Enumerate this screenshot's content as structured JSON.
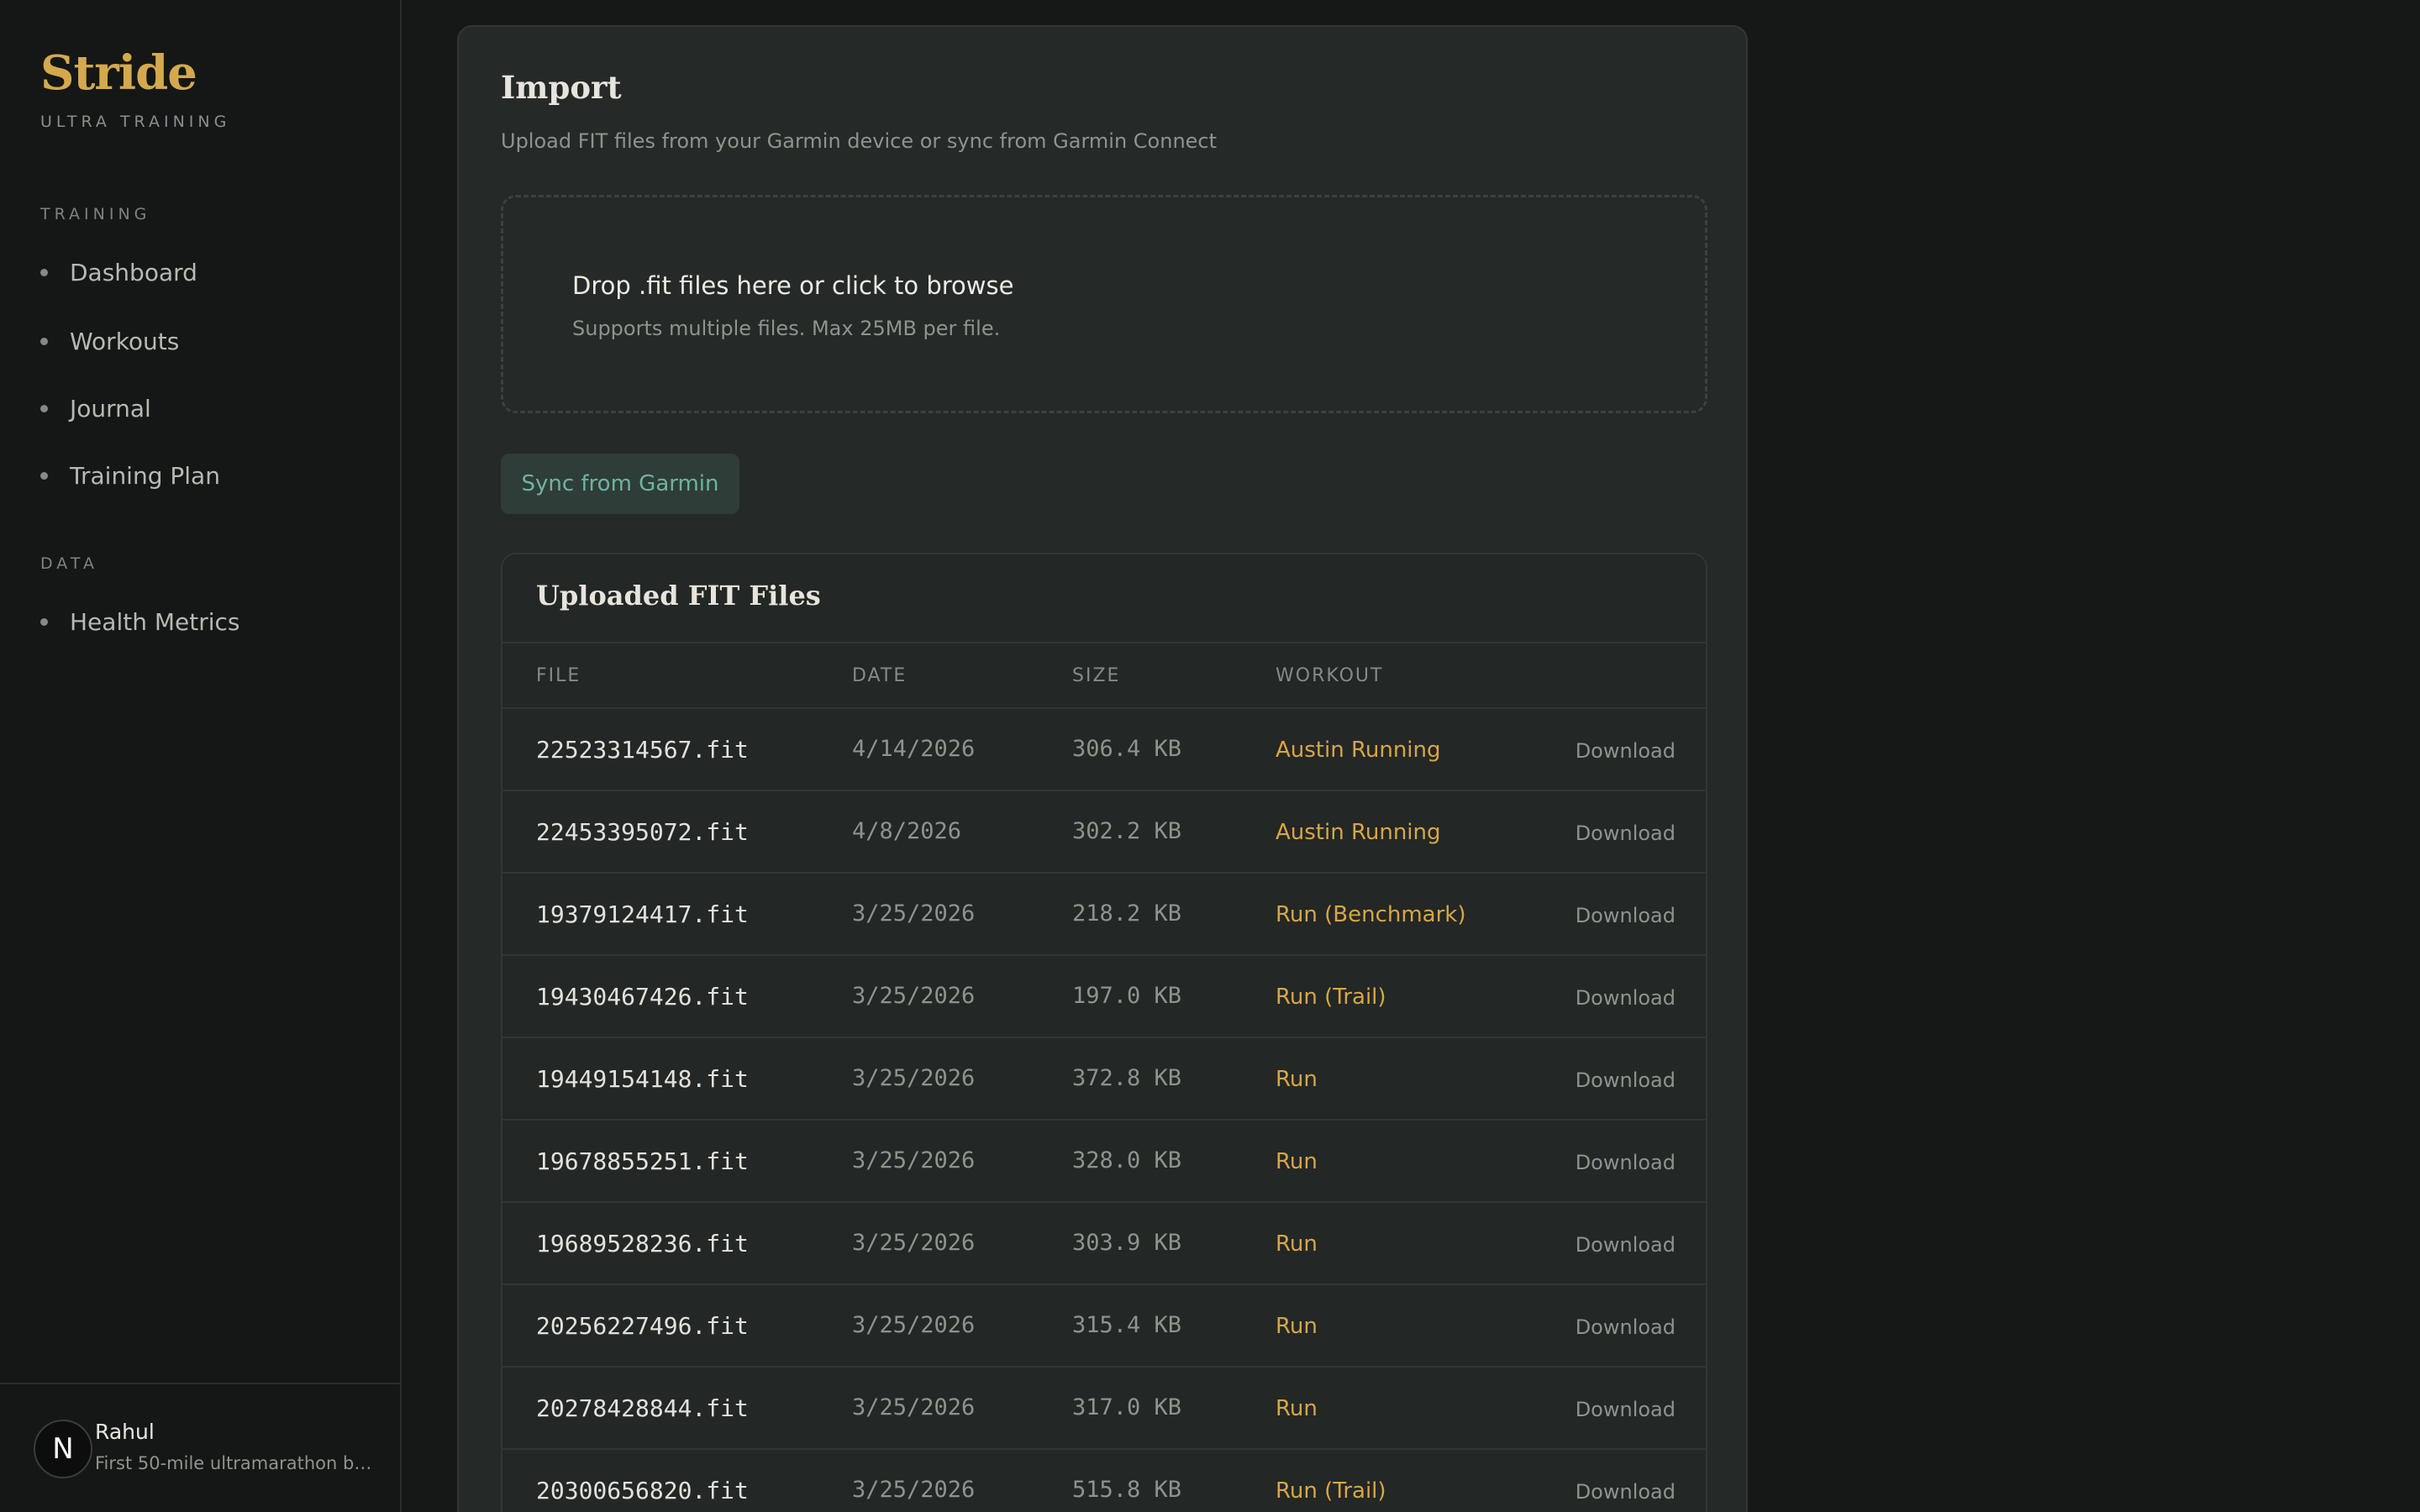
{
  "brand": {
    "name": "Stride",
    "subtitle": "ULTRA TRAINING"
  },
  "sidebar": {
    "sections": [
      {
        "label": "TRAINING",
        "items": [
          "Dashboard",
          "Workouts",
          "Journal",
          "Training Plan"
        ]
      },
      {
        "label": "DATA",
        "items": [
          "Health Metrics"
        ]
      }
    ]
  },
  "user": {
    "initial": "N",
    "name": "Rahul",
    "goal": "First 50-mile ultramarathon by ..."
  },
  "import": {
    "title": "Import",
    "subtitle": "Upload FIT files from your Garmin device or sync from Garmin Connect",
    "drop_title": "Drop .fit files here or click to browse",
    "drop_sub": "Supports multiple files. Max 25MB per file.",
    "sync_label": "Sync from Garmin"
  },
  "files": {
    "title": "Uploaded FIT Files",
    "columns": [
      "FILE",
      "DATE",
      "SIZE",
      "WORKOUT"
    ],
    "download_label": "Download",
    "rows": [
      {
        "file": "22523314567.fit",
        "date": "4/14/2026",
        "size": "306.4 KB",
        "workout": "Austin Running"
      },
      {
        "file": "22453395072.fit",
        "date": "4/8/2026",
        "size": "302.2 KB",
        "workout": "Austin Running"
      },
      {
        "file": "19379124417.fit",
        "date": "3/25/2026",
        "size": "218.2 KB",
        "workout": "Run (Benchmark)"
      },
      {
        "file": "19430467426.fit",
        "date": "3/25/2026",
        "size": "197.0 KB",
        "workout": "Run (Trail)"
      },
      {
        "file": "19449154148.fit",
        "date": "3/25/2026",
        "size": "372.8 KB",
        "workout": "Run"
      },
      {
        "file": "19678855251.fit",
        "date": "3/25/2026",
        "size": "328.0 KB",
        "workout": "Run"
      },
      {
        "file": "19689528236.fit",
        "date": "3/25/2026",
        "size": "303.9 KB",
        "workout": "Run"
      },
      {
        "file": "20256227496.fit",
        "date": "3/25/2026",
        "size": "315.4 KB",
        "workout": "Run"
      },
      {
        "file": "20278428844.fit",
        "date": "3/25/2026",
        "size": "317.0 KB",
        "workout": "Run"
      },
      {
        "file": "20300656820.fit",
        "date": "3/25/2026",
        "size": "515.8 KB",
        "workout": "Run (Trail)"
      }
    ]
  },
  "colors": {
    "accent": "#d4a94e",
    "workout_link": "#d8a646",
    "sync_text": "#6fb3a0"
  }
}
